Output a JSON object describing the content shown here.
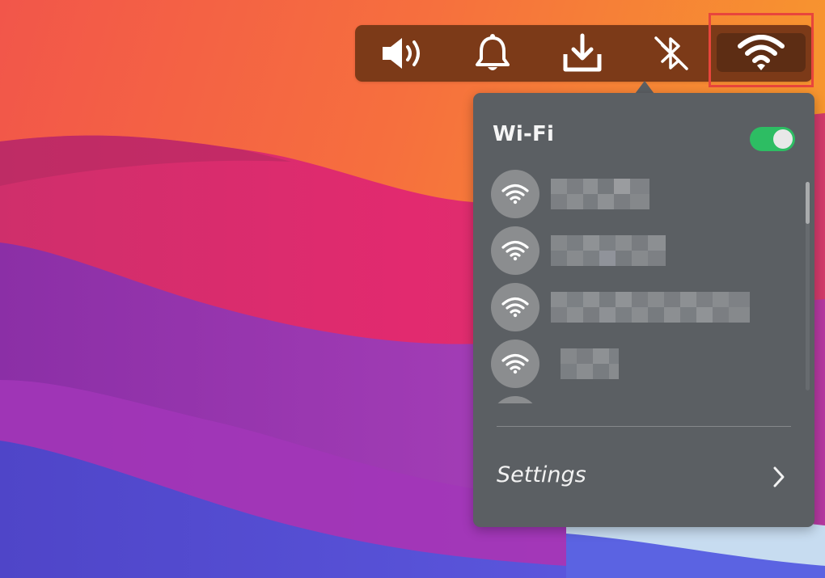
{
  "tray": {
    "icons": [
      "speaker-icon",
      "bell-icon",
      "download-icon",
      "bluetooth-off-icon",
      "wifi-icon"
    ],
    "active_icon": "wifi-icon"
  },
  "wifi_panel": {
    "title": "Wi-Fi",
    "enabled": true,
    "networks_visible": 4,
    "network_names_obscured": true,
    "settings_label": "Settings"
  },
  "colors": {
    "tray_background": "#7c3a18",
    "tray_active_background": "#5d2d14",
    "highlight_border": "#e8453c",
    "panel_background": "#5b5f63",
    "toggle_on": "#2dbd63",
    "network_icon_circle": "#8b8d8f"
  }
}
